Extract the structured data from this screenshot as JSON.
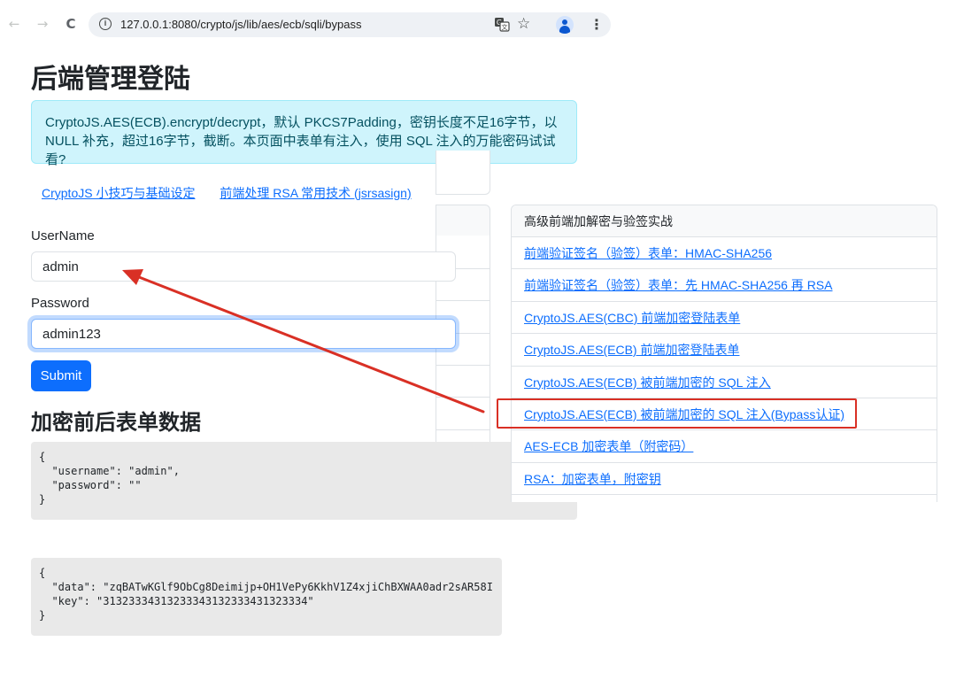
{
  "browser": {
    "url": "127.0.0.1:8080/crypto/js/lib/aes/ecb/sqli/bypass",
    "back_glyph": "←",
    "forward_glyph": "→",
    "reload_glyph": "C",
    "star_glyph": "☆",
    "menu_glyph": "⋮",
    "info_glyph": "i"
  },
  "page": {
    "title": "后端管理登陆",
    "alert_text": "CryptoJS.AES(ECB).encrypt/decrypt，默认 PKCS7Padding，密钥长度不足16字节，以 NULL 补充，超过16字节，截断。本页面中表单有注入，使用 SQL 注入的万能密码试试看?",
    "links": [
      "CryptoJS 小技巧与基础设定",
      "前端处理 RSA 常用技术 (jsrsasign)"
    ]
  },
  "form": {
    "username_label": "UserName",
    "username_value": "admin",
    "password_label": "Password",
    "password_value": "admin123",
    "submit_label": "Submit"
  },
  "data_section": {
    "title": "加密前后表单数据",
    "before_json": "{\n  \"username\": \"admin\",\n  \"password\": \"\"\n}",
    "after_json": "{\n  \"data\": \"zqBATwKGlf9ObCg8Deimijp+OH1VePy6KkhV1Z4xjiChBXWAA0adr2sAR58I\n  \"key\": \"31323334313233343132333431323334\"\n}"
  },
  "panel": {
    "header": "高级前端加解密与验签实战",
    "items": [
      "前端验证签名（验签）表单：HMAC-SHA256",
      "前端验证签名（验签）表单：先 HMAC-SHA256 再 RSA",
      "CryptoJS.AES(CBC) 前端加密登陆表单",
      "CryptoJS.AES(ECB) 前端加密登陆表单",
      "CryptoJS.AES(ECB) 被前端加密的 SQL 注入",
      "CryptoJS.AES(ECB) 被前端加密的 SQL 注入(Bypass认证)",
      "AES-ECB 加密表单（附密码）",
      "RSA：加密表单，附密钥"
    ]
  },
  "colors": {
    "accent": "#0d6efd",
    "alert_bg": "#cff4fc",
    "alert_text": "#055160",
    "annotation_red": "#d93025"
  }
}
